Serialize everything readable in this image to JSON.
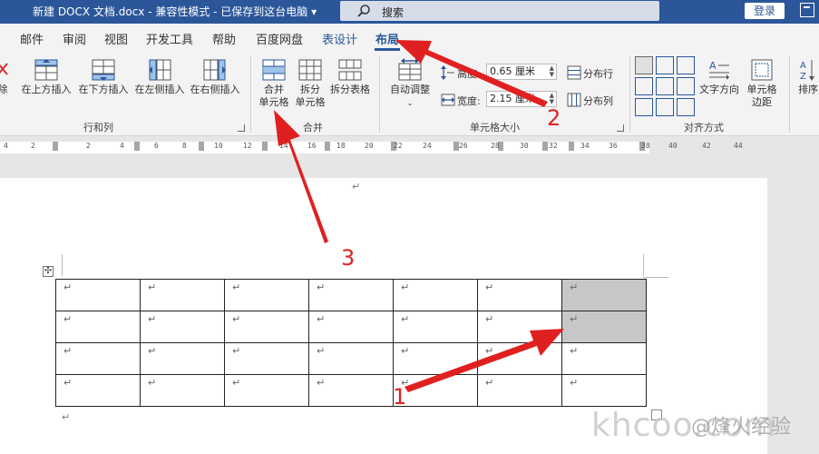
{
  "titlebar": {
    "doc_title": "新建 DOCX 文档.docx  -  兼容性模式  -  已保存到这台电脑  ▾",
    "search_placeholder": "搜索",
    "login": "登录"
  },
  "tabs": [
    {
      "label": "邮件"
    },
    {
      "label": "审阅"
    },
    {
      "label": "视图"
    },
    {
      "label": "开发工具"
    },
    {
      "label": "帮助"
    },
    {
      "label": "百度网盘"
    },
    {
      "label": "表设计"
    },
    {
      "label": "布局"
    }
  ],
  "ribbon": {
    "rows_cols": {
      "partial_label": "除",
      "insert_above": "在上方插入",
      "insert_below": "在下方插入",
      "insert_left": "在左侧插入",
      "insert_right": "在右侧插入",
      "group_label": "行和列"
    },
    "merge": {
      "merge_cells_1": "合并",
      "merge_cells_2": "单元格",
      "split_cells_1": "拆分",
      "split_cells_2": "单元格",
      "split_table": "拆分表格",
      "group_label": "合并"
    },
    "cell_size": {
      "autofit": "自动调整",
      "height_label": "高度:",
      "height_value": "0.65 厘米",
      "width_label": "宽度:",
      "width_value": "2.15 厘米",
      "distribute_rows": "分布行",
      "distribute_cols": "分布列",
      "group_label": "单元格大小"
    },
    "alignment": {
      "text_direction": "文字方向",
      "cell_margins_1": "单元格",
      "cell_margins_2": "边距",
      "group_label": "对齐方式"
    },
    "sort": {
      "label": "排序"
    }
  },
  "ruler": {
    "ticks": [
      "4",
      "2",
      "2",
      "4",
      "6",
      "8",
      "10",
      "12",
      "14",
      "16",
      "18",
      "20",
      "22",
      "24",
      "26",
      "28",
      "30",
      "32",
      "34",
      "36",
      "38",
      "40",
      "42",
      "44"
    ]
  },
  "document": {
    "paragraph_mark": "↵",
    "table_rows": 4,
    "table_cols": 7,
    "selected_cells": [
      [
        0,
        6
      ],
      [
        1,
        6
      ]
    ]
  },
  "annotations": {
    "n1": "1",
    "n2": "2",
    "n3": "3"
  },
  "watermark": {
    "latin": "khcoo.com",
    "cn": "@烽火经验"
  }
}
